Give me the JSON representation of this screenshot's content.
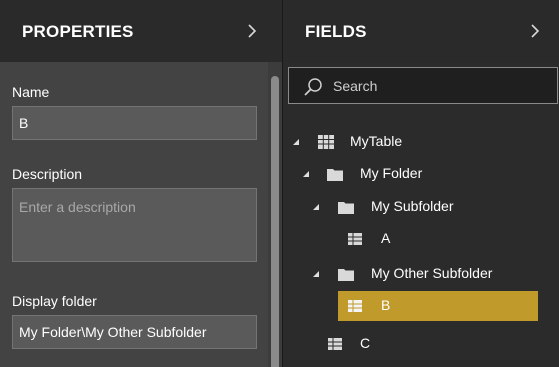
{
  "properties": {
    "title": "PROPERTIES",
    "name_label": "Name",
    "name_value": "B",
    "description_label": "Description",
    "description_placeholder": "Enter a description",
    "display_folder_label": "Display folder",
    "display_folder_value": "My Folder\\My Other Subfolder"
  },
  "fields": {
    "title": "FIELDS",
    "search_placeholder": "Search",
    "tree": {
      "table": "MyTable",
      "folder": "My Folder",
      "subfolder": "My Subfolder",
      "field_a": "A",
      "other_subfolder": "My Other Subfolder",
      "field_b": "B",
      "field_c": "C"
    },
    "selected_item": "B"
  },
  "colors": {
    "selection_accent": "#c09a2a",
    "properties_bg": "#434343",
    "fields_bg": "#2b2b2b"
  },
  "icons": {
    "pane_collapse": "chevron-right-icon",
    "search": "search-icon",
    "table": "table-icon",
    "folder": "folder-icon",
    "field": "field-icon",
    "expanded": "expanded-triangle-icon"
  }
}
